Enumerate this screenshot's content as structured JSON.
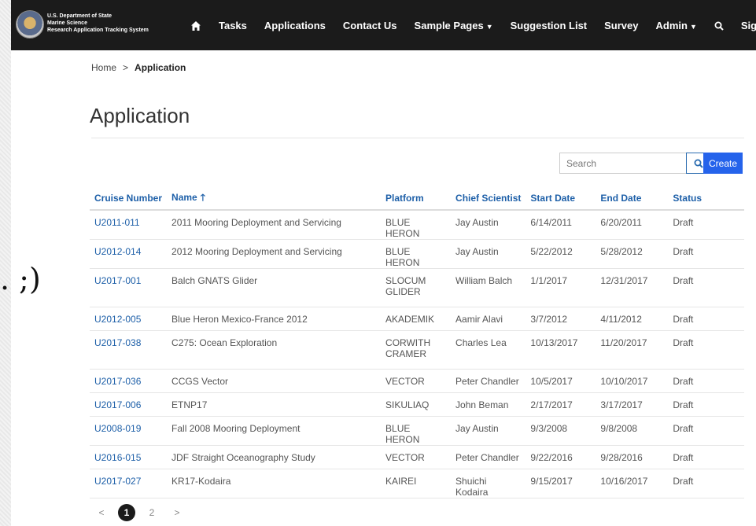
{
  "header": {
    "agency_lines": [
      "U.S. Department of State",
      "Marine Science",
      "Research Application Tracking System"
    ],
    "nav": [
      {
        "label": "Tasks"
      },
      {
        "label": "Applications"
      },
      {
        "label": "Contact Us"
      },
      {
        "label": "Sample Pages",
        "dropdown": true
      },
      {
        "label": "Suggestion List"
      },
      {
        "label": "Survey"
      },
      {
        "label": "Admin",
        "dropdown": true
      }
    ],
    "sign_in": "Sign In"
  },
  "breadcrumb": {
    "home": "Home",
    "separator": ">",
    "current": "Application"
  },
  "page_title": "Application",
  "search": {
    "placeholder": "Search"
  },
  "create_label": "Create",
  "table": {
    "columns": [
      "Cruise Number",
      "Name",
      "Platform",
      "Chief Scientist",
      "Start Date",
      "End Date",
      "Status"
    ],
    "sorted_column": "Name",
    "sort_direction": "ascending",
    "rows": [
      [
        "U2011-011",
        "2011 Mooring Deployment and Servicing",
        "BLUE HERON",
        "Jay Austin",
        "6/14/2011",
        "6/20/2011",
        "Draft"
      ],
      [
        "U2012-014",
        "2012 Mooring Deployment and Servicing",
        "BLUE HERON",
        "Jay Austin",
        "5/22/2012",
        "5/28/2012",
        "Draft"
      ],
      [
        "U2017-001",
        "Balch GNATS Glider",
        "SLOCUM GLIDER",
        "William Balch",
        "1/1/2017",
        "12/31/2017",
        "Draft"
      ],
      [
        "U2012-005",
        "Blue Heron Mexico-France 2012",
        "AKADEMIK",
        "Aamir Alavi",
        "3/7/2012",
        "4/11/2012",
        "Draft"
      ],
      [
        "U2017-038",
        "C275: Ocean Exploration",
        "CORWITH CRAMER",
        "Charles Lea",
        "10/13/2017",
        "11/20/2017",
        "Draft"
      ],
      [
        "U2017-036",
        "CCGS Vector",
        "VECTOR",
        "Peter Chandler",
        "10/5/2017",
        "10/10/2017",
        "Draft"
      ],
      [
        "U2017-006",
        "ETNP17",
        "SIKULIAQ",
        "John Beman",
        "2/17/2017",
        "3/17/2017",
        "Draft"
      ],
      [
        "U2008-019",
        "Fall 2008 Mooring Deployment",
        "BLUE HERON",
        "Jay Austin",
        "9/3/2008",
        "9/8/2008",
        "Draft"
      ],
      [
        "U2016-015",
        "JDF Straight Oceanography Study",
        "VECTOR",
        "Peter Chandler",
        "9/22/2016",
        "9/28/2016",
        "Draft"
      ],
      [
        "U2017-027",
        "KR17-Kodaira",
        "KAIREI",
        "Shuichi Kodaira",
        "9/15/2017",
        "10/16/2017",
        "Draft"
      ]
    ]
  },
  "pager": {
    "prev": "<",
    "pages": [
      "1",
      "2"
    ],
    "current": "1",
    "next": ">"
  },
  "overlay_text": ". ;)",
  "colors": {
    "nav_bg": "#1b1b1b",
    "link": "#1d5fa8",
    "create": "#2563eb"
  }
}
